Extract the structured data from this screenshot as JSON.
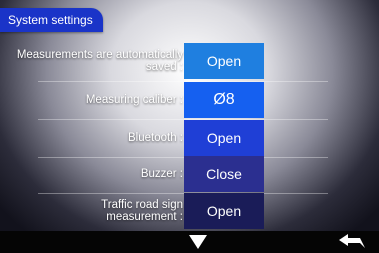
{
  "header": {
    "title": "System settings"
  },
  "settings": [
    {
      "label": "Measurements are automatically saved :",
      "value": "Open",
      "color": "#1f7fe0"
    },
    {
      "label": "Measuring caliber :",
      "value": "Ø8",
      "color": "#1560f0"
    },
    {
      "label": "Bluetooth :",
      "value": "Open",
      "color": "#1f3fd6"
    },
    {
      "label": "Buzzer :",
      "value": "Close",
      "color": "#2b2f90"
    },
    {
      "label": "Traffic road sign measurement :",
      "value": "Open",
      "color": "#1a1c58"
    }
  ],
  "footer": {
    "down_icon": "down-arrow-icon",
    "back_icon": "back-arrow-icon"
  }
}
